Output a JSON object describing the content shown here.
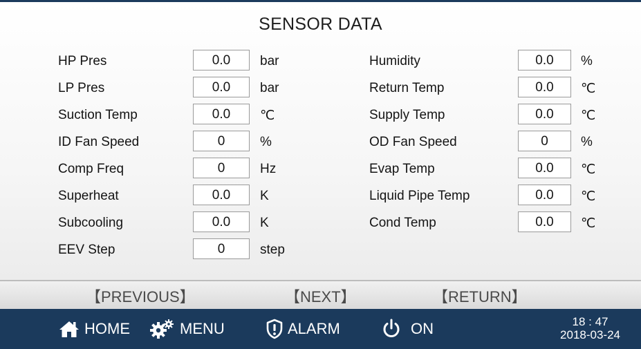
{
  "title": "SENSOR DATA",
  "left_rows": [
    {
      "label": "HP Pres",
      "value": "0.0",
      "unit": "bar"
    },
    {
      "label": "LP Pres",
      "value": "0.0",
      "unit": "bar"
    },
    {
      "label": "Suction Temp",
      "value": "0.0",
      "unit": "℃"
    },
    {
      "label": "ID Fan Speed",
      "value": "0",
      "unit": "%"
    },
    {
      "label": "Comp Freq",
      "value": "0",
      "unit": "Hz"
    },
    {
      "label": "Superheat",
      "value": "0.0",
      "unit": "K"
    },
    {
      "label": "Subcooling",
      "value": "0.0",
      "unit": "K"
    },
    {
      "label": "EEV Step",
      "value": "0",
      "unit": "step"
    }
  ],
  "right_rows": [
    {
      "label": "Humidity",
      "value": "0.0",
      "unit": "%"
    },
    {
      "label": "Return Temp",
      "value": "0.0",
      "unit": "℃"
    },
    {
      "label": "Supply Temp",
      "value": "0.0",
      "unit": "℃"
    },
    {
      "label": "OD Fan Speed",
      "value": "0",
      "unit": "%"
    },
    {
      "label": "Evap Temp",
      "value": "0.0",
      "unit": "℃"
    },
    {
      "label": "Liquid Pipe Temp",
      "value": "0.0",
      "unit": "℃"
    },
    {
      "label": "Cond Temp",
      "value": "0.0",
      "unit": "℃"
    }
  ],
  "nav": {
    "previous": "【PREVIOUS】",
    "next": "【NEXT】",
    "return": "【RETURN】"
  },
  "footer": {
    "home": "HOME",
    "menu": "MENU",
    "alarm": "ALARM",
    "power": "ON",
    "time": "18 : 47",
    "date": "2018-03-24"
  },
  "colors": {
    "footer_bg": "#1b3a5c",
    "footer_text": "#ffffff",
    "nav_text": "#4a4a4a"
  },
  "icons": {
    "home": "home-icon",
    "menu": "gears-icon",
    "alarm": "alarm-shield-icon",
    "power": "power-icon"
  }
}
